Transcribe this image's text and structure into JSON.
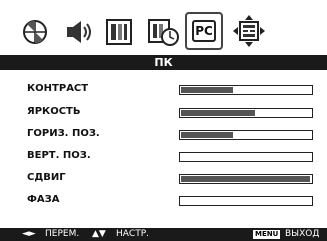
{
  "title": "ПК",
  "toolbar": {
    "icons": [
      "picture-icon",
      "audio-icon",
      "screen-icon",
      "timer-icon",
      "pc-icon",
      "setup-icon"
    ],
    "active": "pc-icon",
    "pc_label": "PC"
  },
  "items": [
    {
      "label": "КОНТРАСТ",
      "level": 0.4
    },
    {
      "label": "ЯРКОСТЬ",
      "level": 0.57
    },
    {
      "label": "ГОРИЗ. ПОЗ.",
      "level": 0.4
    },
    {
      "label": "ВЕРТ. ПОЗ.",
      "level": 0.0
    },
    {
      "label": "СДВИГ",
      "level": 0.99
    },
    {
      "label": "ФАЗА",
      "level": 0.0
    }
  ],
  "footer": {
    "move_glyph": "◄►",
    "move_label": "ПЕРЕМ.",
    "adjust_glyph": "▲▼",
    "adjust_label": "НАСТР.",
    "menu_key": "MENU",
    "exit_label": "ВЫХОД"
  }
}
